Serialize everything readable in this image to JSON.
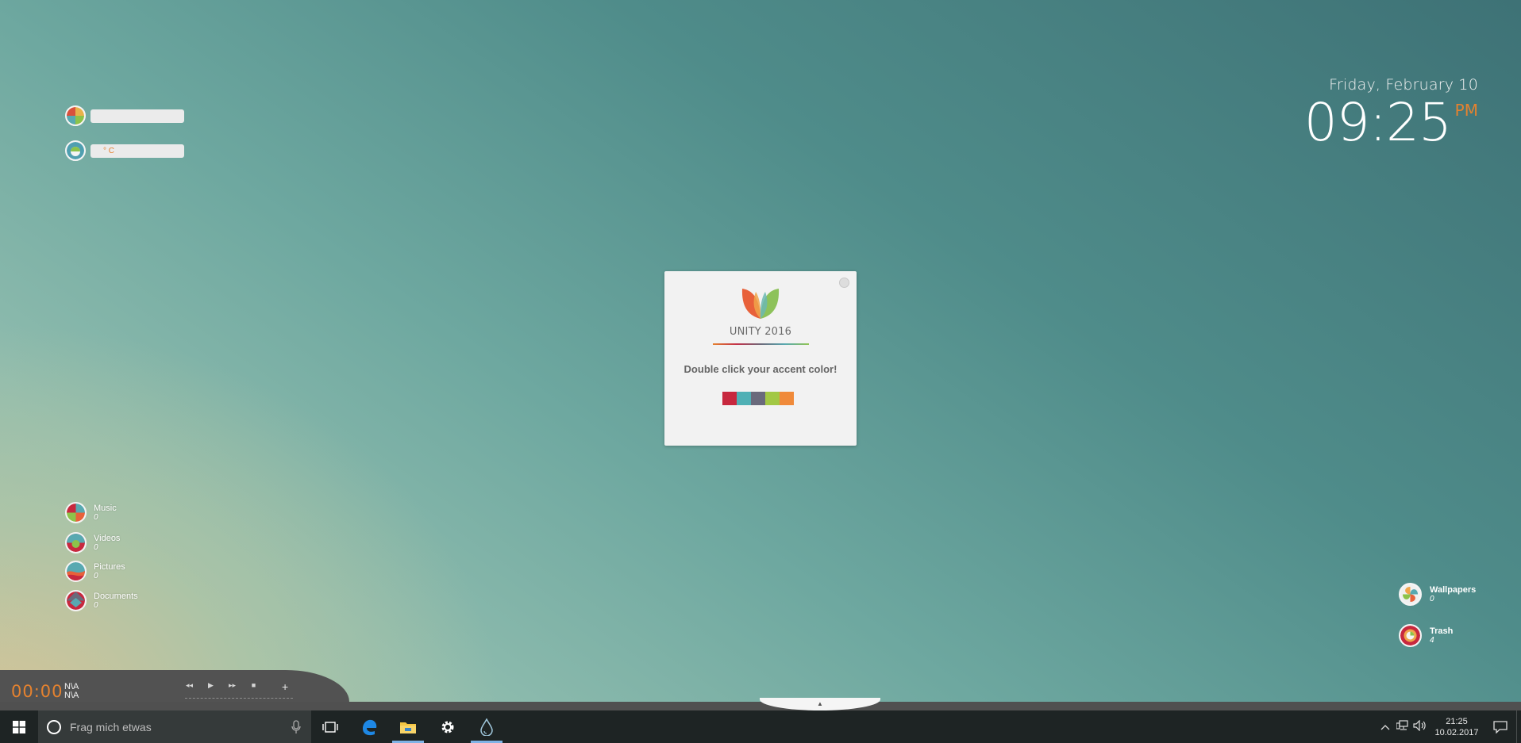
{
  "widgets_topleft": {
    "weather_label": "",
    "temperature_label": "° C"
  },
  "clock": {
    "date": "Friday, February 10",
    "time": "09:25",
    "ampm": "PM"
  },
  "card": {
    "title": "UNITY 2016",
    "instruction": "Double click your accent color!",
    "swatches": [
      "#c7283e",
      "#4fb0b5",
      "#6a6a7c",
      "#a2c844",
      "#f08a3a"
    ]
  },
  "library": [
    {
      "label": "Music",
      "count": "0"
    },
    {
      "label": "Videos",
      "count": "0"
    },
    {
      "label": "Pictures",
      "count": "0"
    },
    {
      "label": "Documents",
      "count": "0"
    }
  ],
  "right_widgets": [
    {
      "label": "Wallpapers",
      "count": "0"
    },
    {
      "label": "Trash",
      "count": "4"
    }
  ],
  "media": {
    "time": "00:00",
    "artist": "N\\A",
    "title": "N\\A",
    "prev": "◂◂",
    "play": "▶",
    "next": "▸▸",
    "stop": "■",
    "add": "+"
  },
  "dock": {
    "handle": "▲"
  },
  "taskbar": {
    "search_placeholder": "Frag mich etwas",
    "clock_time": "21:25",
    "clock_date": "10.02.2017"
  },
  "colors": {
    "accent": "#e5822f",
    "taskbar": "#1e2424",
    "search_box": "#353a3a"
  }
}
